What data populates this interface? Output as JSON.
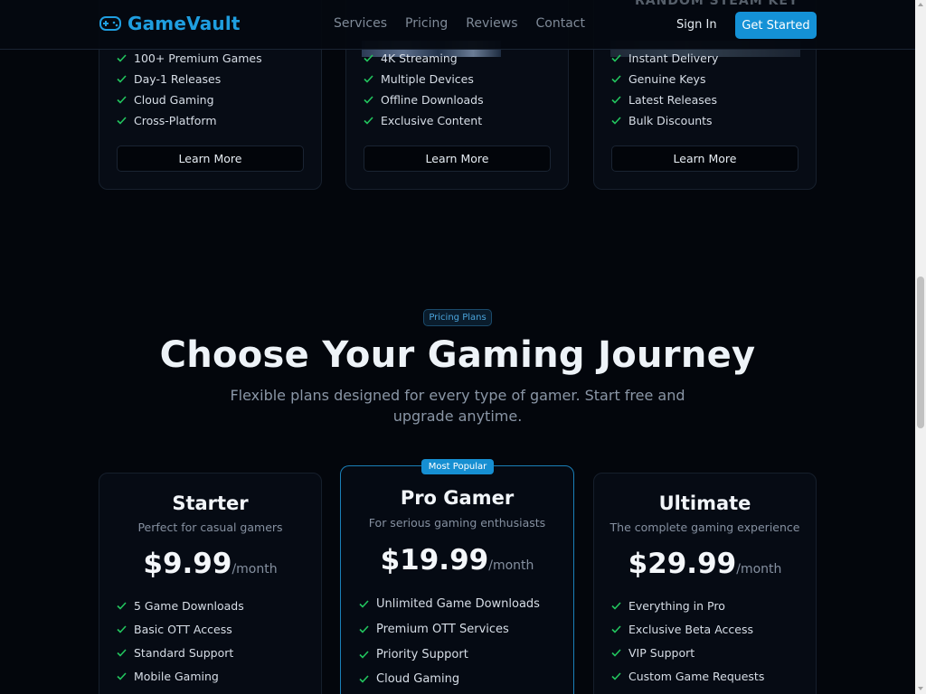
{
  "header": {
    "brand": "GameVault",
    "nav": [
      "Services",
      "Pricing",
      "Reviews",
      "Contact"
    ],
    "signin": "Sign In",
    "cta": "Get Started"
  },
  "services": [
    {
      "features": [
        "100+ Premium Games",
        "Day-1 Releases",
        "Cloud Gaming",
        "Cross-Platform"
      ],
      "button": "Learn More"
    },
    {
      "features": [
        "4K Streaming",
        "Multiple Devices",
        "Offline Downloads",
        "Exclusive Content"
      ],
      "button": "Learn More"
    },
    {
      "image_text": "RANDOM STEAM KEY",
      "features": [
        "Instant Delivery",
        "Genuine Keys",
        "Latest Releases",
        "Bulk Discounts"
      ],
      "button": "Learn More"
    }
  ],
  "pricing": {
    "pill": "Pricing Plans",
    "title": "Choose Your Gaming Journey",
    "subtitle": "Flexible plans designed for every type of gamer. Start free and upgrade anytime.",
    "badge": "Most Popular",
    "plans": [
      {
        "name": "Starter",
        "desc": "Perfect for casual gamers",
        "price": "$9.99",
        "period": "/month",
        "features": [
          "5 Game Downloads",
          "Basic OTT Access",
          "Standard Support",
          "Mobile Gaming"
        ]
      },
      {
        "name": "Pro Gamer",
        "desc": "For serious gaming enthusiasts",
        "price": "$19.99",
        "period": "/month",
        "features": [
          "Unlimited Game Downloads",
          "Premium OTT Services",
          "Priority Support",
          "Cloud Gaming"
        ]
      },
      {
        "name": "Ultimate",
        "desc": "The complete gaming experience",
        "price": "$29.99",
        "period": "/month",
        "features": [
          "Everything in Pro",
          "Exclusive Beta Access",
          "VIP Support",
          "Custom Game Requests"
        ]
      }
    ]
  },
  "colors": {
    "accent": "#1491d6",
    "check": "#22c55e",
    "background": "#03060c"
  }
}
